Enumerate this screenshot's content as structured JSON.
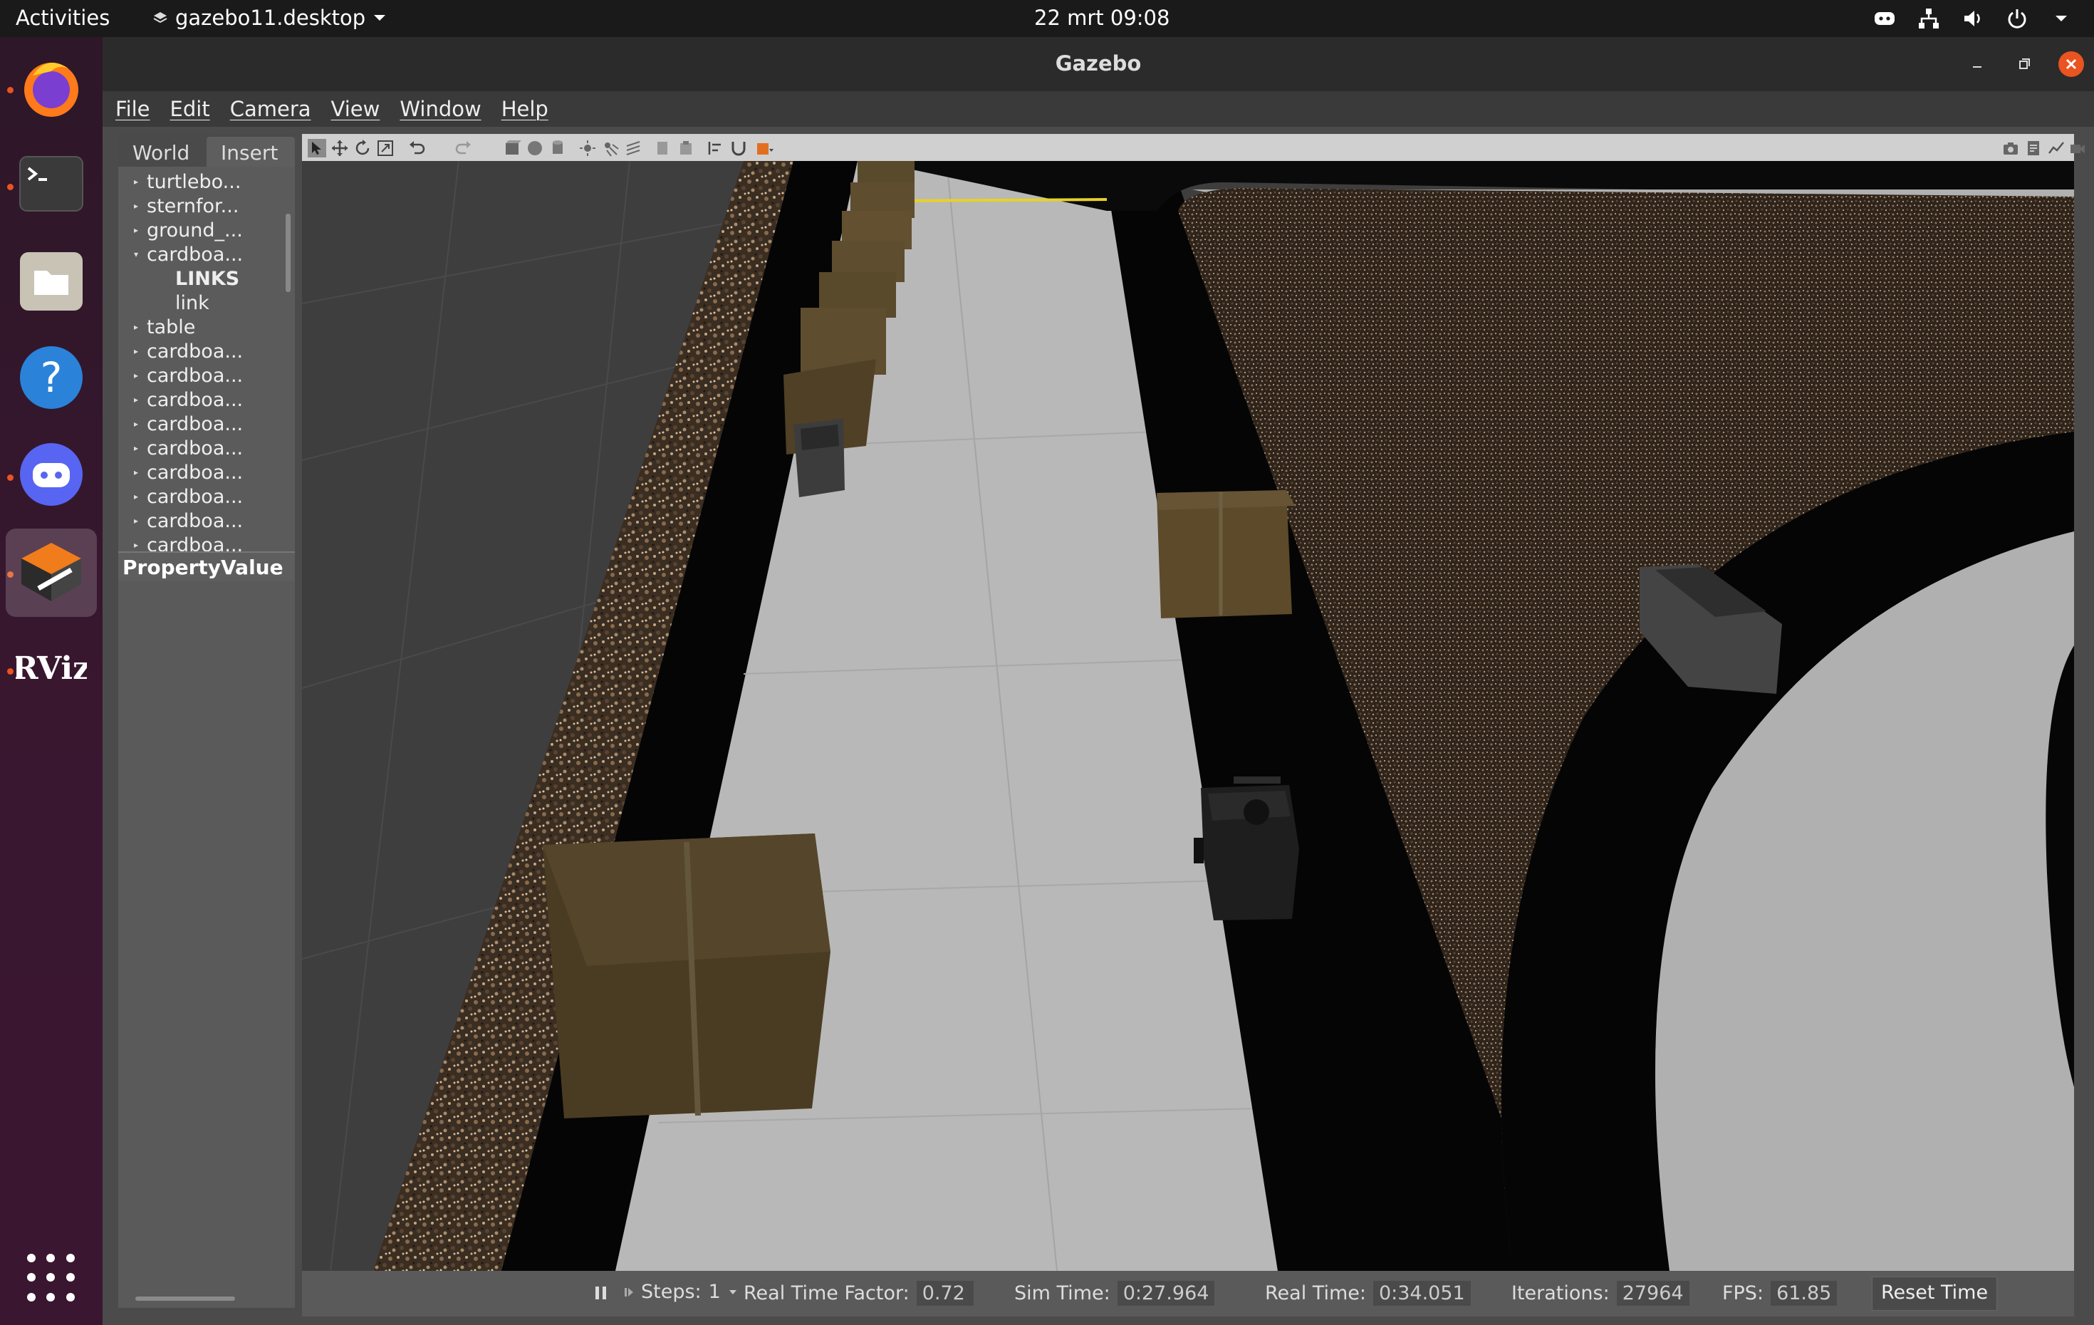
{
  "topbar": {
    "activities": "Activities",
    "app_name": "gazebo11.desktop",
    "clock": "22 mrt  09:08",
    "tray_icons": [
      "discord-icon",
      "network-icon",
      "volume-icon",
      "power-icon",
      "chevron-down-icon"
    ]
  },
  "dock": {
    "items": [
      {
        "name": "firefox",
        "running": true
      },
      {
        "name": "terminal",
        "running": true
      },
      {
        "name": "files",
        "running": false
      },
      {
        "name": "help",
        "running": false
      },
      {
        "name": "discord",
        "running": true
      },
      {
        "name": "gazebo",
        "running": true,
        "active": true
      },
      {
        "name": "rviz",
        "running": true
      }
    ],
    "rviz_label": "RViz"
  },
  "window": {
    "title": "Gazebo",
    "menu": [
      "File",
      "Edit",
      "Camera",
      "View",
      "Window",
      "Help"
    ]
  },
  "left_panel": {
    "tabs": [
      "World",
      "Insert"
    ],
    "tree": [
      {
        "label": "turtlebo...",
        "arrow": "right",
        "indent": 0
      },
      {
        "label": "sternfor...",
        "arrow": "right",
        "indent": 0
      },
      {
        "label": "ground_...",
        "arrow": "right",
        "indent": 0
      },
      {
        "label": "cardboa...",
        "arrow": "down",
        "indent": 0
      },
      {
        "label": "LINKS",
        "arrow": "",
        "indent": 1,
        "bold": true
      },
      {
        "label": "link",
        "arrow": "",
        "indent": 1
      },
      {
        "label": "table",
        "arrow": "right",
        "indent": 0
      },
      {
        "label": "cardboa...",
        "arrow": "right",
        "indent": 0
      },
      {
        "label": "cardboa...",
        "arrow": "right",
        "indent": 0
      },
      {
        "label": "cardboa...",
        "arrow": "right",
        "indent": 0
      },
      {
        "label": "cardboa...",
        "arrow": "right",
        "indent": 0
      },
      {
        "label": "cardboa...",
        "arrow": "right",
        "indent": 0
      },
      {
        "label": "cardboa...",
        "arrow": "right",
        "indent": 0
      },
      {
        "label": "cardboa...",
        "arrow": "right",
        "indent": 0
      },
      {
        "label": "cardboa...",
        "arrow": "right",
        "indent": 0
      },
      {
        "label": "cardboa...",
        "arrow": "right",
        "indent": 0
      }
    ],
    "property_header": "PropertyValue"
  },
  "status": {
    "steps_label": "Steps:",
    "steps_value": "1",
    "rtf_label": "Real Time Factor:",
    "rtf_value": "0.72",
    "sim_label": "Sim Time:",
    "sim_value": "0:27.964",
    "real_label": "Real Time:",
    "real_value": "0:34.051",
    "iter_label": "Iterations:",
    "iter_value": "27964",
    "fps_label": "FPS:",
    "fps_value": "61.85",
    "reset_label": "Reset Time"
  },
  "colors": {
    "accent": "#e95420",
    "road": "#b9b9b9",
    "gravel": "#6a5240",
    "box": "#5a4a2a"
  }
}
